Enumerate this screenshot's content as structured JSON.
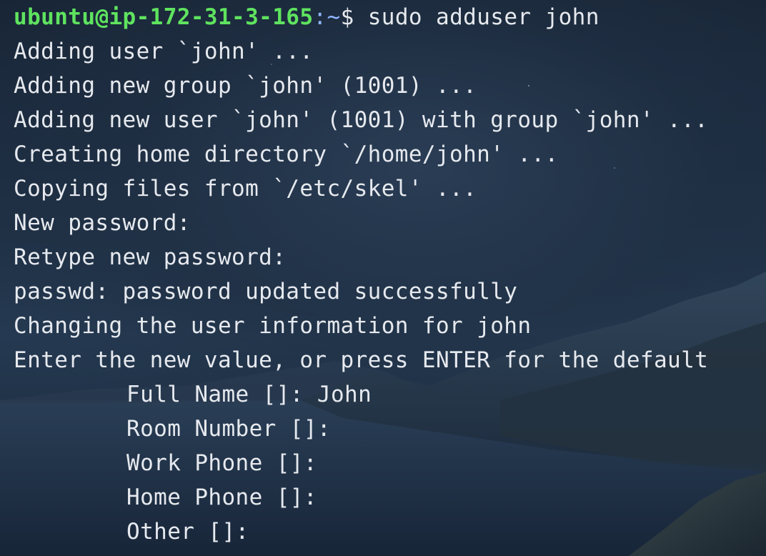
{
  "terminal": {
    "prompt_user": "ubuntu@ip-172-31-3-165",
    "prompt_colon": ":",
    "prompt_path": "~",
    "prompt_symbol": "$ ",
    "command": "sudo adduser john",
    "output_lines": [
      "Adding user `john' ...",
      "Adding new group `john' (1001) ...",
      "Adding new user `john' (1001) with group `john' ...",
      "Creating home directory `/home/john' ...",
      "Copying files from `/etc/skel' ...",
      "New password:",
      "Retype new password:",
      "passwd: password updated successfully",
      "Changing the user information for john",
      "Enter the new value, or press ENTER for the default"
    ],
    "indented_lines": [
      "Full Name []: John",
      "Room Number []:",
      "Work Phone []:",
      "Home Phone []:",
      "Other []:"
    ]
  },
  "colors": {
    "prompt_user": "#5fe35f",
    "prompt_path": "#8fb5ff",
    "text": "#e6e9ee",
    "background": "#1c2a3c"
  }
}
